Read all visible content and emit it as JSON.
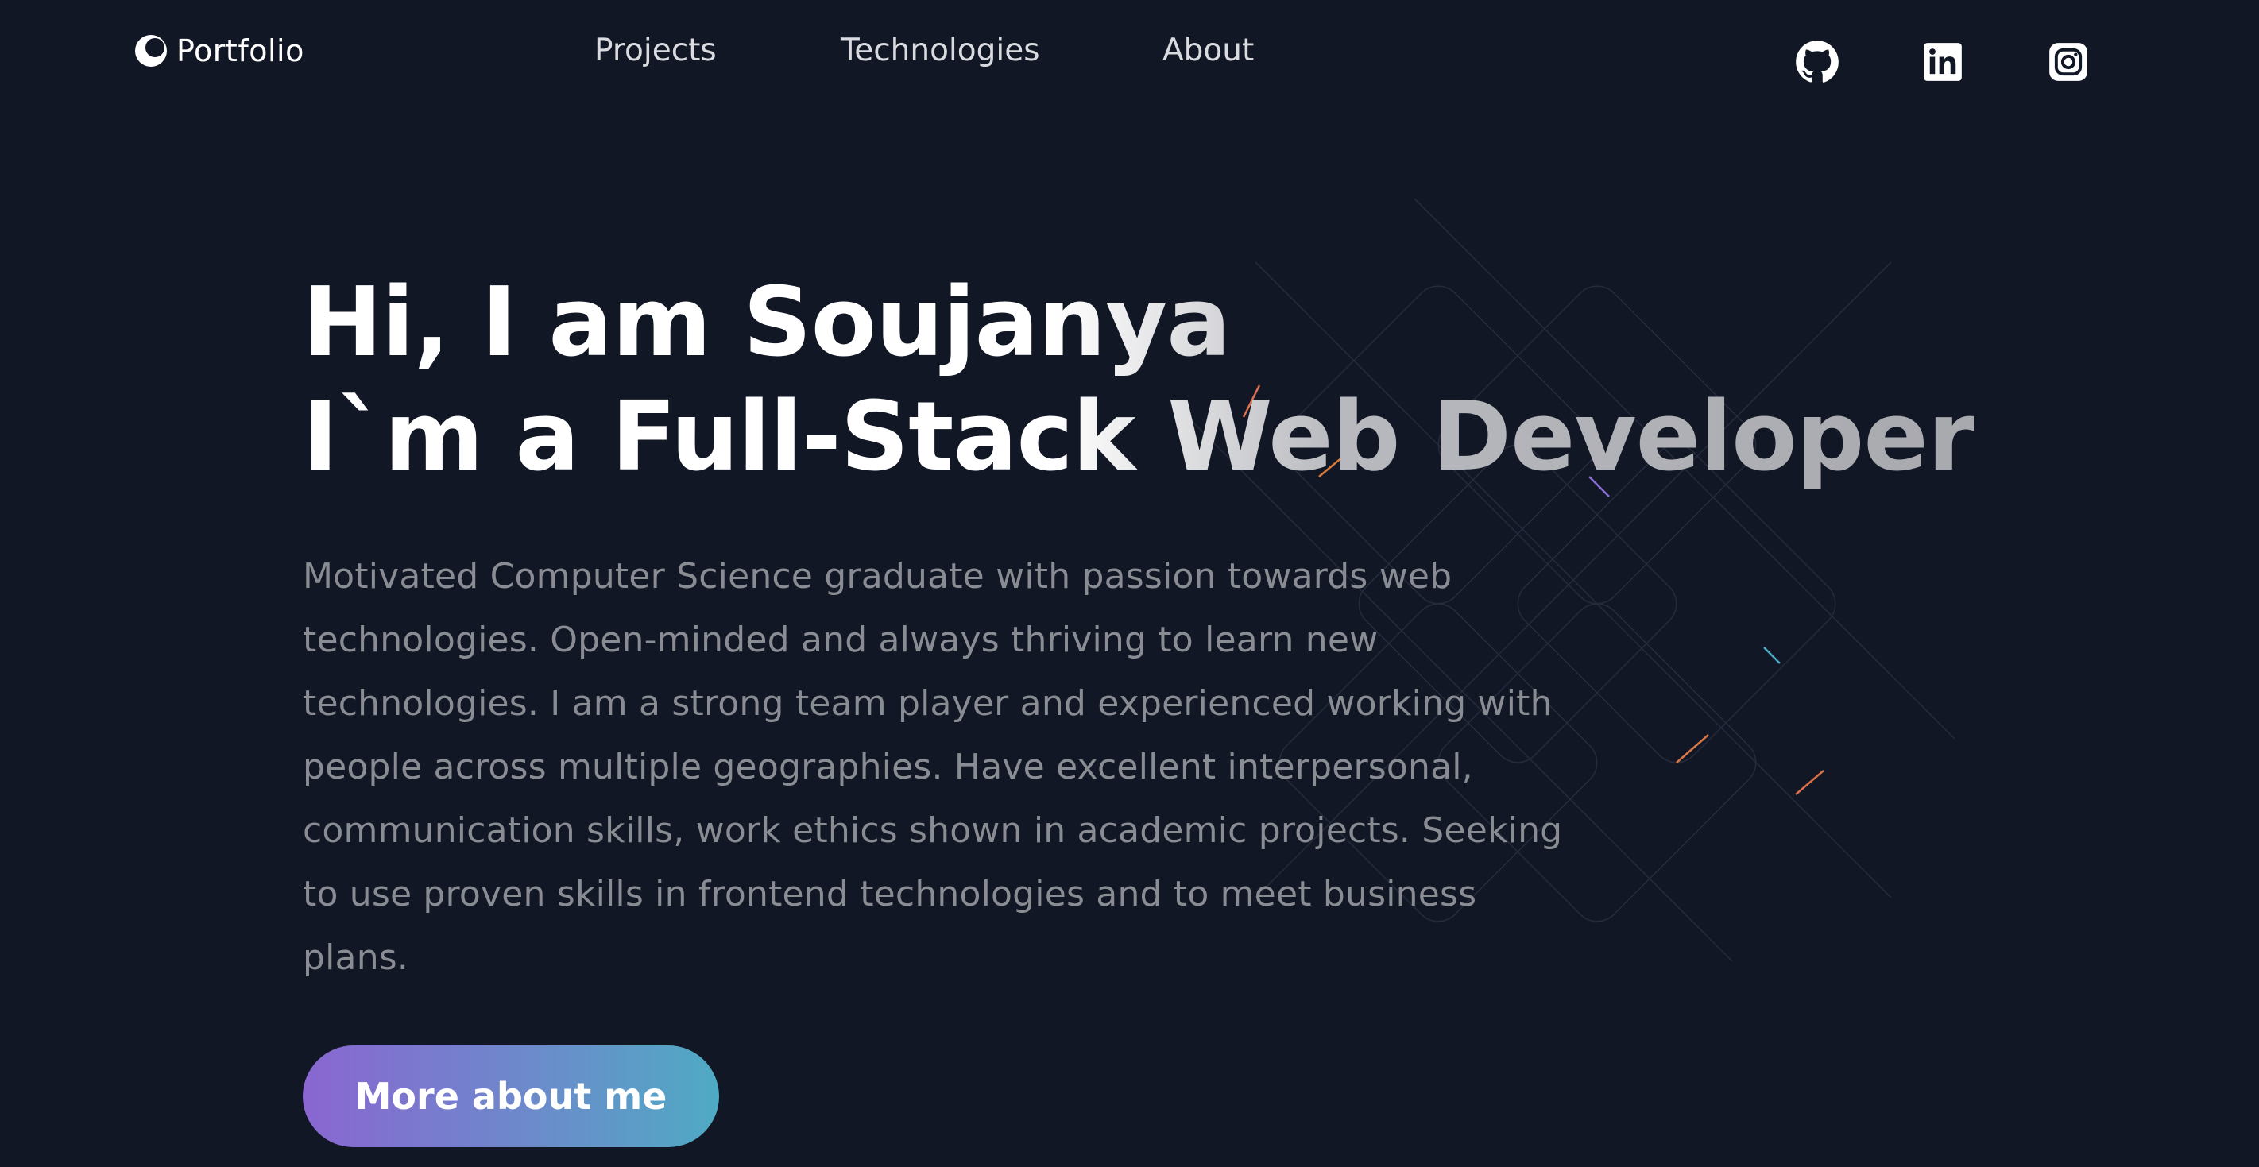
{
  "header": {
    "logo_text": "Portfolio",
    "nav": [
      {
        "label": "Projects"
      },
      {
        "label": "Technologies"
      },
      {
        "label": "About"
      }
    ],
    "social": [
      {
        "icon": "github-icon"
      },
      {
        "icon": "linkedin-icon"
      },
      {
        "icon": "instagram-icon"
      }
    ]
  },
  "hero": {
    "title_line1": "Hi, I am Soujanya",
    "title_line2": "I`m a Full-Stack Web Developer",
    "description": "Motivated Computer Science graduate with passion towards web technologies. Open-minded and always thriving to learn new technologies. I am a strong team player and experienced working with people across multiple geographies. Have excellent interpersonal, communication skills, work ethics shown in academic projects. Seeking to use proven skills in frontend technologies and to meet business plans.",
    "cta_label": "More about me"
  },
  "colors": {
    "background": "#111724",
    "nav_text": "#d9dbe0",
    "description_text": "#8a8c93",
    "cta_gradient_start": "#8a66d1",
    "cta_gradient_end": "#4faac4"
  }
}
